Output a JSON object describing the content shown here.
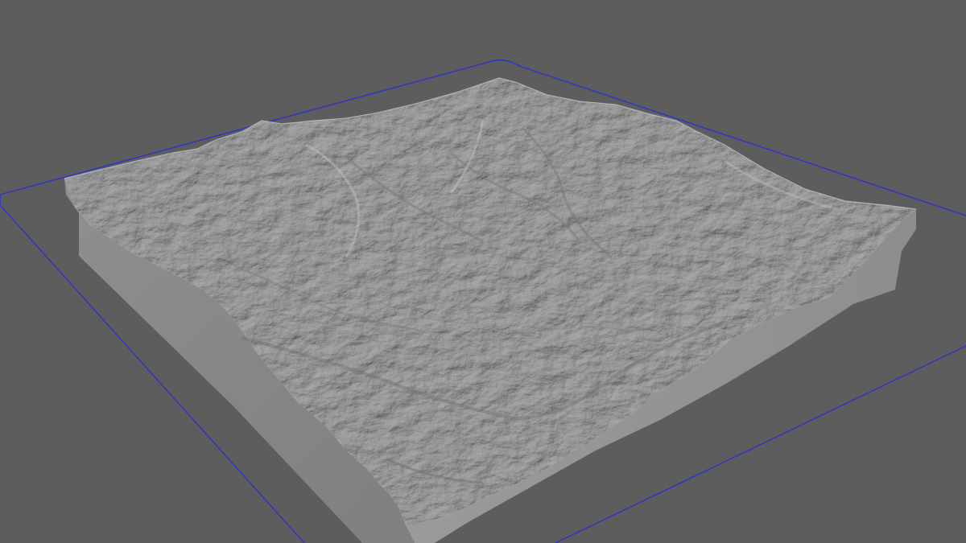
{
  "viewport": {
    "background_color": "#5d5d5d",
    "outline_color": "#2f33c8",
    "model": {
      "name": "terrain-relief-block",
      "top_color": "#aaaaaa",
      "left_side_color": "#8a8a8a",
      "right_side_color": "#989898"
    }
  }
}
